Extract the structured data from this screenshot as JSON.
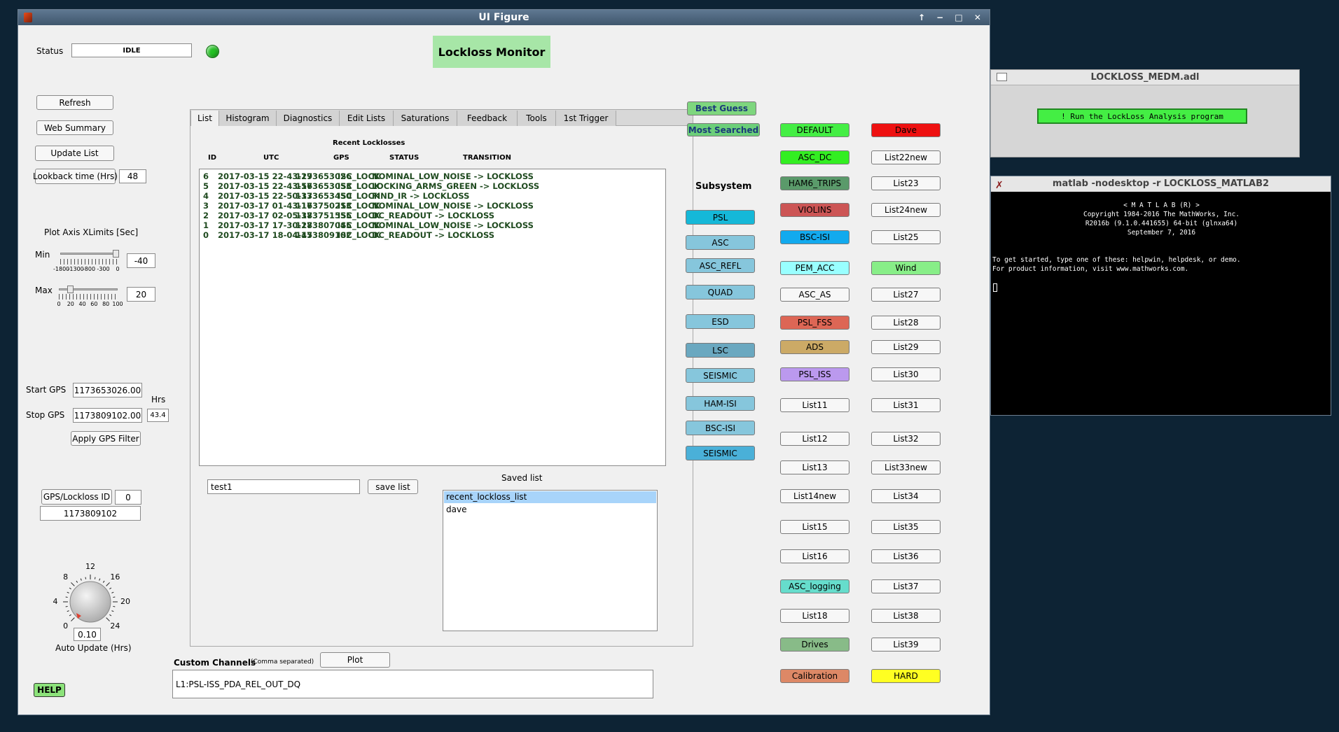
{
  "window": {
    "title": "UI Figure",
    "controls": "↑ − □ ✕"
  },
  "status": {
    "label": "Status",
    "value": "IDLE",
    "led_color": "#22c022"
  },
  "header": {
    "title": "Lockloss Monitor"
  },
  "left": {
    "refresh": "Refresh",
    "web_summary": "Web Summary",
    "update_list": "Update List",
    "lookback_label": "Lookback time (Hrs)",
    "lookback_value": "48",
    "xlim_title": "Plot Axis XLimits [Sec]",
    "min_label": "Min",
    "min_value": "-40",
    "min_ticks": [
      "-1800",
      "-1300",
      "-800",
      "-300",
      "0"
    ],
    "min_slider_fraction": 0.98,
    "max_label": "Max",
    "max_value": "20",
    "max_ticks": [
      "0",
      "20",
      "40",
      "60",
      "80",
      "100"
    ],
    "max_slider_fraction": 0.2,
    "start_gps_label": "Start GPS",
    "start_gps_value": "1173653026.00",
    "stop_gps_label": "Stop GPS",
    "stop_gps_value": "1173809102.00",
    "hrs_label": "Hrs",
    "hrs_value": "43.4",
    "apply_gps": "Apply GPS Filter",
    "gps_id_label": "GPS/Lockloss ID",
    "gps_id_value": "0",
    "gps_value": "1173809102",
    "knob_ticks": [
      "0",
      "4",
      "8",
      "12",
      "16",
      "20",
      "24"
    ],
    "knob_value": "0.10",
    "auto_update_label": "Auto Update (Hrs)",
    "help": "HELP"
  },
  "tabs": [
    "List",
    "Histogram",
    "Diagnostics",
    "Edit Lists",
    "Saturations",
    "Feedback",
    "Tools",
    "1st Trigger"
  ],
  "locklosses": {
    "title": "Recent Locklosses",
    "headers": [
      "ID",
      "UTC",
      "GPS",
      "STATUS",
      "TRANSITION"
    ],
    "rows": [
      {
        "id": "6",
        "utc": "2017-03-15 22-43-29",
        "gps": "1173653026",
        "status": "ISC_LOCK",
        "transition": "NOMINAL_LOW_NOISE -> LOCKLOSS"
      },
      {
        "id": "5",
        "utc": "2017-03-15 22-43-56",
        "gps": "1173653053",
        "status": "ISC_LOCK",
        "transition": "LOCKING_ARMS_GREEN -> LOCKLOSS"
      },
      {
        "id": "4",
        "utc": "2017-03-15 22-50-33",
        "gps": "1173653450",
        "status": "ISC_LOCK",
        "transition": "FIND_IR -> LOCKLOSS"
      },
      {
        "id": "3",
        "utc": "2017-03-17 01-43-16",
        "gps": "1173750213",
        "status": "ISC_LOCK",
        "transition": "NOMINAL_LOW_NOISE -> LOCKLOSS"
      },
      {
        "id": "2",
        "utc": "2017-03-17 02-05-38",
        "gps": "1173751555",
        "status": "ISC_LOCK",
        "transition": "DC_READOUT -> LOCKLOSS"
      },
      {
        "id": "1",
        "utc": "2017-03-17 17-30-28",
        "gps": "1173807045",
        "status": "ISC_LOCK",
        "transition": "NOMINAL_LOW_NOISE -> LOCKLOSS"
      },
      {
        "id": "0",
        "utc": "2017-03-17 18-04-45",
        "gps": "1173809102",
        "status": "ISC_LOCK",
        "transition": "DC_READOUT -> LOCKLOSS"
      }
    ]
  },
  "save": {
    "input_value": "test1",
    "button": "save list",
    "saved_title": "Saved list",
    "saved_items": [
      "recent_lockloss_list",
      "dave"
    ]
  },
  "custom": {
    "label": "Custom Channels",
    "hint": "(Comma separated)",
    "plot": "Plot",
    "value": "L1:PSL-ISS_PDA_REL_OUT_DQ"
  },
  "guess": {
    "best": "Best Guess",
    "most": "Most Searched"
  },
  "subsystem": {
    "title": "Subsystem",
    "items": [
      "PSL",
      "ASC",
      "ASC_REFL",
      "QUAD",
      "ESD",
      "LSC",
      "SEISMIC",
      "HAM-ISI",
      "BSC-ISI",
      "SEISMIC"
    ],
    "colors": [
      "#15b8d8",
      "#86c6dc",
      "#86c6dc",
      "#86c6dc",
      "#86c6dc",
      "#6aa8c0",
      "#86c6dc",
      "#86c6dc",
      "#86c6dc",
      "#4ab0d8"
    ]
  },
  "lists_col1": [
    {
      "label": "DEFAULT",
      "color": "#44ee44"
    },
    {
      "label": "ASC_DC",
      "color": "#33ee22"
    },
    {
      "label": "HAM6_TRIPS",
      "color": "#5a9a6a"
    },
    {
      "label": "VIOLINS",
      "color": "#cc5555"
    },
    {
      "label": "BSC-ISI",
      "color": "#12aaee"
    },
    {
      "label": "PEM_ACC",
      "color": "#99ffff"
    },
    {
      "label": "ASC_AS",
      "color": "#f7f7f7"
    },
    {
      "label": "PSL_FSS",
      "color": "#dd6655"
    },
    {
      "label": "ADS",
      "color": "#ccaa66"
    },
    {
      "label": "PSL_ISS",
      "color": "#bb99ee"
    },
    {
      "label": "List11",
      "color": "#f7f7f7"
    },
    {
      "label": "List12",
      "color": "#f7f7f7"
    },
    {
      "label": "List13",
      "color": "#f7f7f7"
    },
    {
      "label": "List14new",
      "color": "#f7f7f7"
    },
    {
      "label": "List15",
      "color": "#f7f7f7"
    },
    {
      "label": "List16",
      "color": "#f7f7f7"
    },
    {
      "label": "ASC_logging",
      "color": "#66ddcc"
    },
    {
      "label": "List18",
      "color": "#f7f7f7"
    },
    {
      "label": "Drives",
      "color": "#88bb88"
    },
    {
      "label": "Calibration",
      "color": "#dd8866"
    }
  ],
  "lists_col2": [
    {
      "label": "Dave",
      "color": "#ee1111"
    },
    {
      "label": "List22new",
      "color": "#f7f7f7"
    },
    {
      "label": "List23",
      "color": "#f7f7f7"
    },
    {
      "label": "List24new",
      "color": "#f7f7f7"
    },
    {
      "label": "List25",
      "color": "#f7f7f7"
    },
    {
      "label": "Wind",
      "color": "#88ee88"
    },
    {
      "label": "List27",
      "color": "#f7f7f7"
    },
    {
      "label": "List28",
      "color": "#f7f7f7"
    },
    {
      "label": "List29",
      "color": "#f7f7f7"
    },
    {
      "label": "List30",
      "color": "#f7f7f7"
    },
    {
      "label": "List31",
      "color": "#f7f7f7"
    },
    {
      "label": "List32",
      "color": "#f7f7f7"
    },
    {
      "label": "List33new",
      "color": "#f7f7f7"
    },
    {
      "label": "List34",
      "color": "#f7f7f7"
    },
    {
      "label": "List35",
      "color": "#f7f7f7"
    },
    {
      "label": "List36",
      "color": "#f7f7f7"
    },
    {
      "label": "List37",
      "color": "#f7f7f7"
    },
    {
      "label": "List38",
      "color": "#f7f7f7"
    },
    {
      "label": "List39",
      "color": "#f7f7f7"
    },
    {
      "label": "HARD",
      "color": "#ffff22"
    }
  ],
  "medm": {
    "title": "LOCKLOSS_MEDM.adl",
    "button": "! Run the LockLoss Analysis program"
  },
  "terminal": {
    "title": "matlab -nodesktop -r LOCKLOSS_MATLAB2",
    "lines": [
      "< M A T L A B (R) >",
      "Copyright 1984-2016 The MathWorks, Inc.",
      "R2016b (9.1.0.441655) 64-bit (glnxa64)",
      "September 7, 2016"
    ],
    "help_lines": [
      "To get started, type one of these: helpwin, helpdesk, or demo.",
      "For product information, visit www.mathworks.com."
    ]
  }
}
